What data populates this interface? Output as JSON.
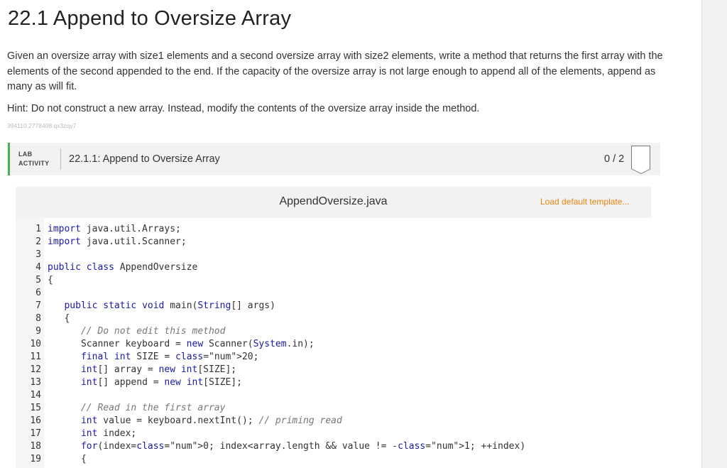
{
  "page": {
    "title": "22.1 Append to Oversize Array",
    "description": "Given an oversize array with size1 elements and a second oversize array with size2 elements, write a method that returns the first array with the elements of the second appended to the end. If the capacity of the oversize array is not large enough to append all of the elements, append as many as will fit.",
    "hint": "Hint: Do not construct a new array. Instead, modify the contents of the oversize array inside the method.",
    "code_id": "394110.2778408.qx3zqy7"
  },
  "lab": {
    "label_line1": "LAB",
    "label_line2": "ACTIVITY",
    "name": "22.1.1: Append to Oversize Array",
    "score": "0 / 2",
    "accent_color": "#4caf50"
  },
  "editor": {
    "filename": "AppendOversize.java",
    "load_template": "Load default template...",
    "lines": [
      {
        "n": "1",
        "code": "import java.util.Arrays;"
      },
      {
        "n": "2",
        "code": "import java.util.Scanner;"
      },
      {
        "n": "3",
        "code": ""
      },
      {
        "n": "4",
        "code": "public class AppendOversize"
      },
      {
        "n": "5",
        "code": "{"
      },
      {
        "n": "6",
        "code": ""
      },
      {
        "n": "7",
        "code": "   public static void main(String[] args)"
      },
      {
        "n": "8",
        "code": "   {"
      },
      {
        "n": "9",
        "code": "      // Do not edit this method"
      },
      {
        "n": "10",
        "code": "      Scanner keyboard = new Scanner(System.in);"
      },
      {
        "n": "11",
        "code": "      final int SIZE = 20;"
      },
      {
        "n": "12",
        "code": "      int[] array = new int[SIZE];"
      },
      {
        "n": "13",
        "code": "      int[] append = new int[SIZE];"
      },
      {
        "n": "14",
        "code": ""
      },
      {
        "n": "15",
        "code": "      // Read in the first array"
      },
      {
        "n": "16",
        "code": "      int value = keyboard.nextInt(); // priming read"
      },
      {
        "n": "17",
        "code": "      int index;"
      },
      {
        "n": "18",
        "code": "      for(index=0; index<array.length && value != -1; ++index)"
      },
      {
        "n": "19",
        "code": "      {"
      }
    ]
  }
}
